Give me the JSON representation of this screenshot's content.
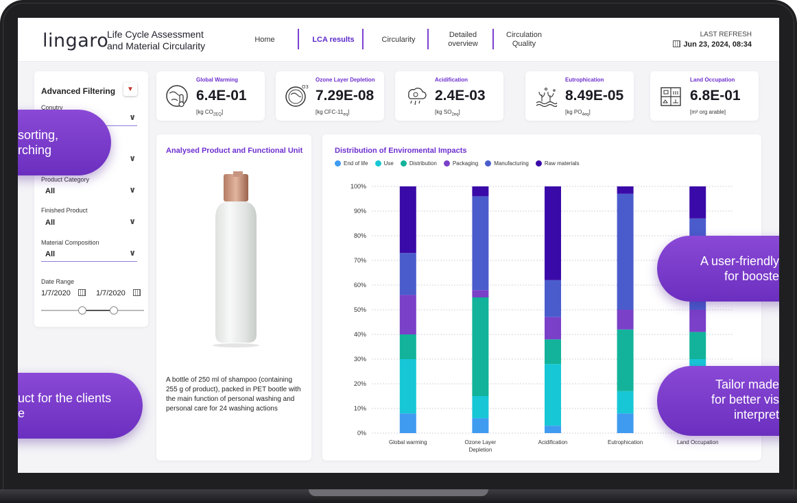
{
  "header": {
    "logo_text": "lingaro",
    "app_title_line1": "Life Cycle Assessment",
    "app_title_line2": "and Material Circularity",
    "nav": [
      {
        "label": "Home"
      },
      {
        "label": "LCA results",
        "active": true
      },
      {
        "label": "Circularity"
      },
      {
        "label_line1": "Detailed",
        "label_line2": "overview"
      },
      {
        "label_line1": "Circulation",
        "label_line2": "Quality"
      }
    ],
    "refresh_label": "LAST REFRESH",
    "refresh_date": "Jun 23, 2024, 08:34"
  },
  "filter": {
    "title": "Advanced Filtering",
    "country_label": "Conutry",
    "product_category_label": "Product Category",
    "product_category_value": "All",
    "finished_product_label": "Finished Product",
    "finished_product_value": "All",
    "material_composition_label": "Material Composition",
    "material_composition_value": "All",
    "date_range_label": "Date Range",
    "date_from": "1/7/2020",
    "date_to": "1/7/2020"
  },
  "kpis": [
    {
      "title": "Global Warming",
      "value": "6.4E-01",
      "unit_main": "[kg CO",
      "unit_sub": "2EQ",
      "unit_end": "]"
    },
    {
      "title": "Ozone Layer Depletion",
      "value": "7.29E-08",
      "unit_main": "[kg CFC-11",
      "unit_sub": "eq",
      "unit_end": "]"
    },
    {
      "title": "Acidification",
      "value": "2.4E-03",
      "unit_main": "[kg SO",
      "unit_sub": "2eq",
      "unit_end": "]"
    },
    {
      "title": "Eutrophication",
      "value": "8.49E-05",
      "unit_main": "[kg PO",
      "unit_sub": "4eq",
      "unit_end": "]"
    },
    {
      "title": "Land Occupation",
      "value": "6.8E-01",
      "unit_main": "[m² org arable]",
      "unit_sub": "",
      "unit_end": ""
    }
  ],
  "product": {
    "title": "Analysed Product and Functional Unit",
    "description": "A bottle of 250 ml of shampoo (containing 255 g of product), packed in PET bootle with the main function of personal washing and personal care for 24 washing actions"
  },
  "chart_data": {
    "type": "bar",
    "stacked": true,
    "title": "Distribution of Enviromental Impacts",
    "categories": [
      "Global warming",
      "Ozone Layer Depletion",
      "Acidification",
      "Eutrophication",
      "Land Occupation"
    ],
    "y_tick_labels": [
      "0%",
      "10%",
      "20%",
      "30%",
      "40%",
      "50%",
      "60%",
      "70%",
      "80%",
      "90%",
      "100%"
    ],
    "ylim": [
      0,
      100
    ],
    "legend_position": "top-left",
    "series": [
      {
        "name": "End of life",
        "color": "#3f9bf0",
        "values": [
          8,
          6,
          3,
          8,
          0
        ]
      },
      {
        "name": "Use",
        "color": "#17c7d6",
        "values": [
          22,
          9,
          25,
          9,
          30
        ]
      },
      {
        "name": "Distribution",
        "color": "#12b39a",
        "values": [
          10,
          40,
          10,
          25,
          11
        ]
      },
      {
        "name": "Packaging",
        "color": "#7a40c8",
        "values": [
          16,
          3,
          9,
          8,
          9
        ]
      },
      {
        "name": "Manufacturing",
        "color": "#4a5ccc",
        "values": [
          17,
          38,
          15,
          47,
          37
        ]
      },
      {
        "name": "Raw materials",
        "color": "#3a0aa8",
        "values": [
          27,
          4,
          38,
          3,
          13
        ]
      }
    ]
  },
  "overlays": {
    "pill1_line1": "sorting,",
    "pill1_line2": "rching",
    "pill2_line1": "uct for the clients",
    "pill2_line2": "e",
    "pill3_line1": "A user-friendly",
    "pill3_line2": "for booste",
    "pill4_line1": "Tailor made",
    "pill4_line2": "for better vis",
    "pill4_line3": "interpret"
  }
}
